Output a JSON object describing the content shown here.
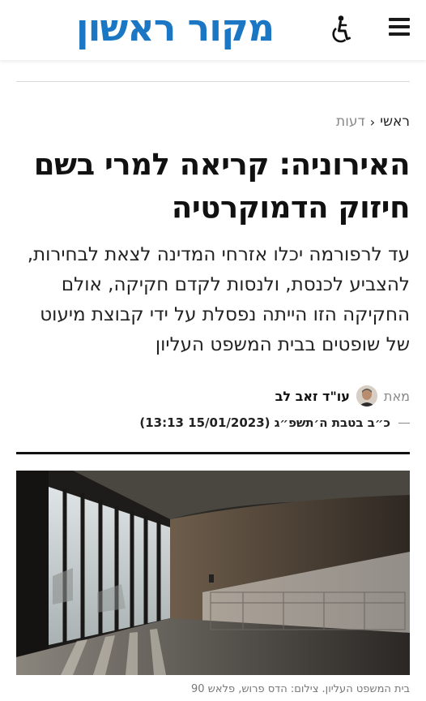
{
  "header": {
    "logo_text": "מקור ראשון",
    "logo_color": "#1b77c4"
  },
  "breadcrumb": {
    "home": "ראשי",
    "separator": "‹",
    "section": "דעות"
  },
  "article": {
    "headline": "האירוניה: קריאה למרי בשם חיזוק הדמוקרטיה",
    "subtitle": "עד לרפורמה יכלו אזרחי המדינה לצאת לבחירות, להצביע לכנסת, ולנסות לקדם חקיקה, אולם החקיקה הזו הייתה נפסלת על ידי קבוצת מיעוט של שופטים בבית המשפט העליון",
    "byline_prefix": "מאת",
    "author": "עו\"ד זאב לב",
    "date": "כ״ב בטבת ה׳תשפ״ג (15/01/2023 13:13)",
    "image_caption": "בית המשפט העליון. צילום: הדס פרוש, פלאש 90"
  },
  "icons": {
    "menu": "hamburger-menu-icon",
    "accessibility": "wheelchair-icon"
  }
}
